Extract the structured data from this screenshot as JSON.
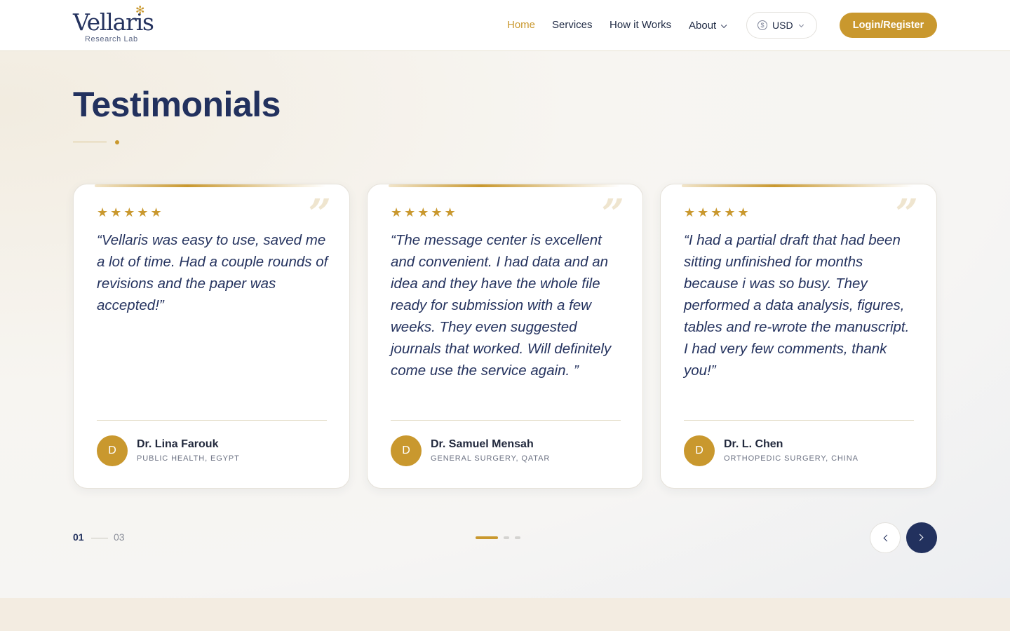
{
  "brand": {
    "name": "Vellaris",
    "tagline": "Research Lab",
    "accent_color": "#c9982e",
    "navy_color": "#22315e"
  },
  "nav": {
    "items": [
      {
        "label": "Home",
        "active": true
      },
      {
        "label": "Services",
        "active": false
      },
      {
        "label": "How it Works",
        "active": false
      },
      {
        "label": "About",
        "active": false,
        "has_dropdown": true
      }
    ],
    "currency": {
      "icon": "dollar-coin-icon",
      "selected": "USD"
    },
    "login_label": "Login/Register"
  },
  "section": {
    "title": "Testimonials"
  },
  "testimonials": [
    {
      "rating": "★★★★★",
      "quote": "“Vellaris was easy to use, saved me a lot of time. Had a couple rounds of revisions and the paper was accepted!”",
      "initial": "D",
      "name": "Dr. Lina Farouk",
      "role": "PUBLIC HEALTH, EGYPT"
    },
    {
      "rating": "★★★★★",
      "quote": "“The message center is excellent and convenient. I had data and an idea and they have the whole file ready for submission with a few weeks. They even suggested journals that worked. Will definitely come use the service again. ”",
      "initial": "D",
      "name": "Dr. Samuel Mensah",
      "role": "GENERAL SURGERY, QATAR"
    },
    {
      "rating": "★★★★★",
      "quote": "“I had a partial draft that had been sitting unfinished for months because i was so busy. They performed a data analysis, figures, tables and re-wrote the manuscript. I had very few comments, thank you!”",
      "initial": "D",
      "name": "Dr. L. Chen",
      "role": "ORTHOPEDIC SURGERY, CHINA"
    }
  ],
  "pager": {
    "current": "01",
    "total": "03"
  }
}
